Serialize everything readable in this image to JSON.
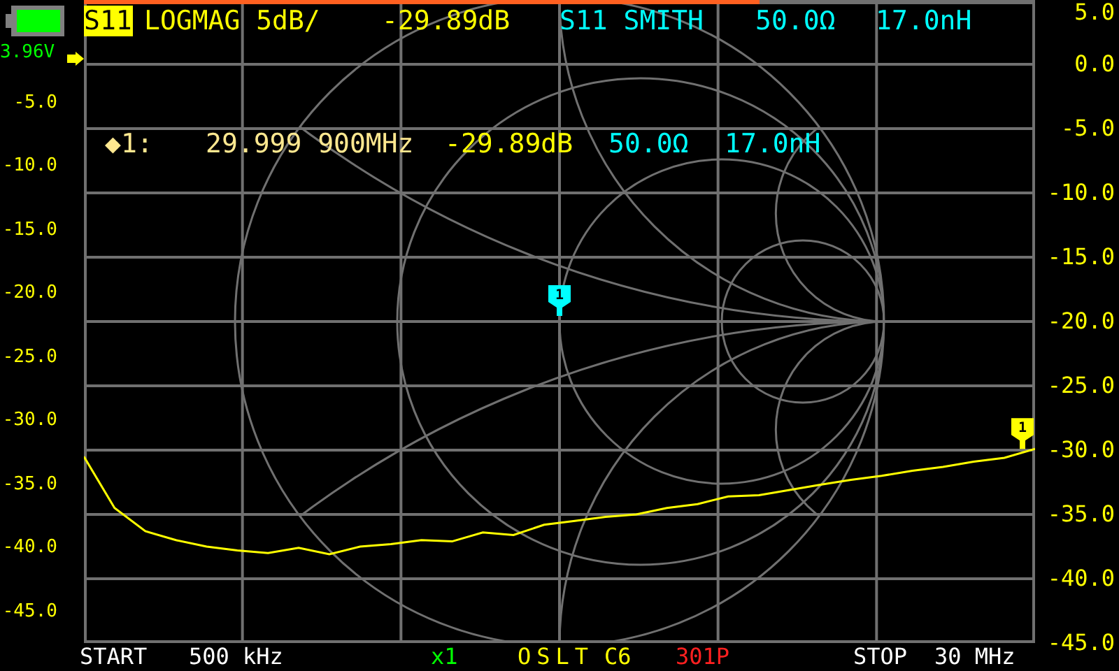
{
  "battery": {
    "voltage": "3.96V"
  },
  "sweep_progress": {
    "level": 0.71
  },
  "header": {
    "channel_badge": "S11",
    "trace1_format": "LOGMAG 5dB/",
    "trace1_value": "-29.89dB",
    "trace2_format": "S11 SMITH",
    "trace2_resistance": "50.0Ω",
    "trace2_reactance": "17.0nH"
  },
  "marker_readout": {
    "marker": "◆1:",
    "frequency": "29.999 900MHz",
    "logmag": "-29.89dB",
    "resistance": "50.0Ω",
    "reactance": "17.0nH"
  },
  "left_scale": [
    "-5.0",
    "-10.0",
    "-15.0",
    "-20.0",
    "-25.0",
    "-30.0",
    "-35.0",
    "-40.0",
    "-45.0"
  ],
  "chart_data": {
    "type": "line",
    "grid": true,
    "ylim": [
      -45,
      5
    ],
    "categories": [
      null,
      null,
      null,
      null,
      null,
      null,
      null,
      null,
      null,
      null,
      null,
      null,
      null,
      null,
      null,
      null,
      null,
      null,
      null,
      null,
      null,
      null,
      null,
      null,
      null,
      null,
      null,
      null,
      null,
      null,
      null,
      null
    ],
    "series": [
      {
        "color": "#ffff00",
        "values": [
          -30.5,
          -34.5,
          -36.3,
          -37.0,
          -37.5,
          -37.8,
          -38.0,
          -37.6,
          -38.1,
          -37.5,
          -37.3,
          -37.0,
          -37.1,
          -36.4,
          -36.6,
          -35.8,
          -35.5,
          -35.2,
          -35.0,
          -34.5,
          -34.2,
          -33.6,
          -33.5,
          -33.1,
          -32.7,
          -32.3,
          -32.0,
          -31.6,
          -31.3,
          -30.9,
          -30.6,
          -29.9
        ]
      }
    ],
    "yticks": [
      {
        "value": 5,
        "label": "5.0"
      },
      {
        "value": 0,
        "label": "0.0"
      },
      {
        "value": -5,
        "label": "-5.0"
      },
      {
        "value": -10,
        "label": "-10.0"
      },
      {
        "value": -15,
        "label": "-15.0"
      },
      {
        "value": -20,
        "label": "-20.0"
      },
      {
        "value": -25,
        "label": "-25.0"
      },
      {
        "value": -30,
        "label": "-30.0"
      },
      {
        "value": -35,
        "label": "-35.0"
      },
      {
        "value": -40,
        "label": "-40.0"
      },
      {
        "value": -45,
        "label": "-45.0"
      }
    ]
  },
  "trace_marker": {
    "label": "1"
  },
  "smith_marker": {
    "label": "1"
  },
  "footer": {
    "start_label": "START",
    "start_value": "500 kHz",
    "zoom": "x1",
    "calibration": "OSLT",
    "cal_slot": "C6",
    "points": "301P",
    "stop_label": "STOP",
    "stop_value": "30 MHz"
  }
}
